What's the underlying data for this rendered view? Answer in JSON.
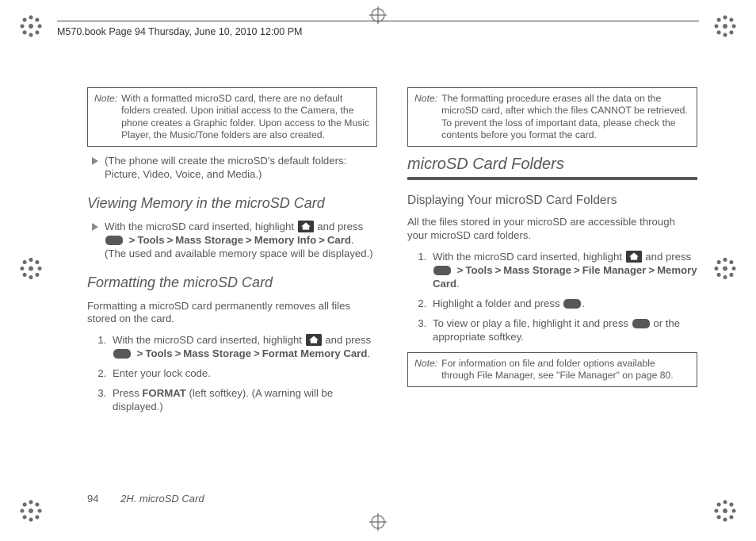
{
  "header_stamp": "M570.book  Page 94  Thursday, June 10, 2010  12:00 PM",
  "col1": {
    "note1": {
      "label": "Note:",
      "body": "With a formatted microSD card, there are no default folders created. Upon initial access to the Camera, the phone creates a Graphic folder. Upon access to the Music Player, the Music/Tone folders are also created."
    },
    "bullet1": "(The phone will create the microSD's default folders: Picture, Video, Voice, and Media.)",
    "h_viewing": "Viewing Memory in the microSD Card",
    "view_pre": "With the microSD card inserted, highlight ",
    "and_press": " and press ",
    "nav_tools": "Tools",
    "nav_mass": "Mass Storage",
    "nav_memoryinfo": "Memory Info",
    "nav_card": "Card",
    "view_post": ". (The used and available memory space will be displayed.)",
    "h_format": "Formatting the microSD Card",
    "format_intro": "Formatting a microSD card permanently removes all files stored on the card.",
    "step1_pre": "With the microSD card inserted, highlight ",
    "nav_formatcard": "Format Memory Card",
    "step2": "Enter your lock code.",
    "step3_pre": "Press ",
    "step3_format": "FORMAT",
    "step3_post": " (left softkey). (A warning will be displayed.)"
  },
  "col2": {
    "note2": {
      "label": "Note:",
      "body": "The formatting procedure erases all the data on the microSD card, after which the files CANNOT be retrieved. To prevent the loss of important data, please check the contents before you format the card."
    },
    "h_folders": "microSD Card Folders",
    "h_display": "Displaying Your microSD Card Folders",
    "intro": "All the files stored in your microSD are accessible through your microSD card folders.",
    "step1_pre": "With the microSD card inserted, highlight ",
    "nav_tools": "Tools",
    "nav_mass": "Mass Storage",
    "nav_file": "File Manager",
    "nav_memc": "Memory Card",
    "step2_pre": "Highlight a folder and press ",
    "step3_pre": "To view or play a file, highlight it and press ",
    "step3_post": " or the appropriate softkey.",
    "note3": {
      "label": "Note:",
      "body": "For information on file and folder options available through File Manager, see \"File Manager\" on page 80."
    }
  },
  "footer": {
    "page_num": "94",
    "title": "2H. microSD Card"
  },
  "gt": ">",
  "period": "."
}
